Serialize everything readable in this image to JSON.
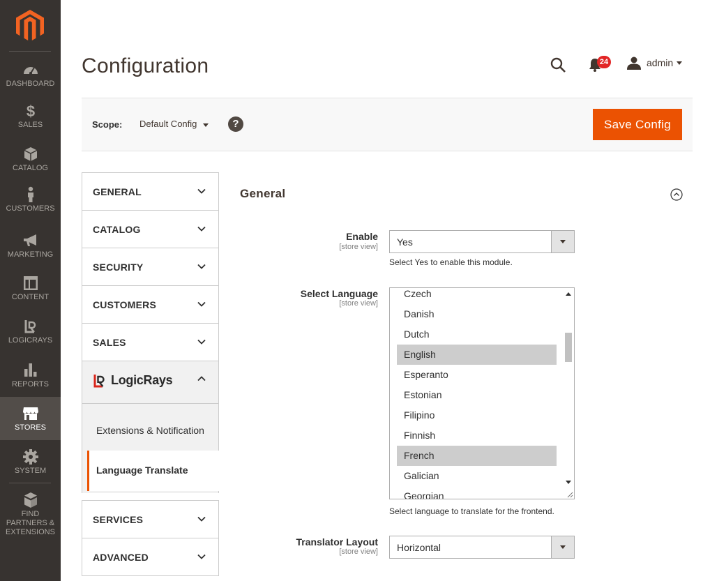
{
  "sidebar": {
    "items": [
      {
        "label": "DASHBOARD",
        "icon": "dashboard-icon"
      },
      {
        "label": "SALES",
        "icon": "dollar-icon"
      },
      {
        "label": "CATALOG",
        "icon": "box-icon"
      },
      {
        "label": "CUSTOMERS",
        "icon": "person-icon"
      },
      {
        "label": "MARKETING",
        "icon": "megaphone-icon"
      },
      {
        "label": "CONTENT",
        "icon": "layout-icon"
      },
      {
        "label": "LOGICRAYS",
        "icon": "logicrays-icon"
      },
      {
        "label": "REPORTS",
        "icon": "bar-chart-icon"
      },
      {
        "label": "STORES",
        "icon": "store-icon",
        "active": true
      },
      {
        "label": "SYSTEM",
        "icon": "gear-icon"
      },
      {
        "label": "FIND PARTNERS & EXTENSIONS",
        "icon": "blocks-icon"
      }
    ]
  },
  "header": {
    "title": "Configuration",
    "notifications_count": "24",
    "user": "admin"
  },
  "scope": {
    "label": "Scope:",
    "value": "Default Config",
    "help": "?",
    "save_label": "Save Config"
  },
  "tabs": {
    "general": "GENERAL",
    "catalog": "CATALOG",
    "security": "SECURITY",
    "customers": "CUSTOMERS",
    "sales": "SALES",
    "logicrays": "LogicRays",
    "sub_extensions": "Extensions & Notification",
    "sub_language": "Language Translate",
    "services": "SERVICES",
    "advanced": "ADVANCED"
  },
  "section": {
    "title": "General",
    "enable": {
      "label": "Enable",
      "scope": "[store view]",
      "value": "Yes",
      "note": "Select Yes to enable this module."
    },
    "language": {
      "label": "Select Language",
      "scope": "[store view]",
      "options": [
        "Czech",
        "Danish",
        "Dutch",
        "English",
        "Esperanto",
        "Estonian",
        "Filipino",
        "Finnish",
        "French",
        "Galician",
        "Georgian"
      ],
      "selected": [
        "English",
        "French"
      ],
      "note": "Select language to translate for the frontend."
    },
    "layout": {
      "label": "Translator Layout",
      "scope": "[store view]",
      "value": "Horizontal"
    }
  },
  "colors": {
    "accent": "#eb5202",
    "sidebar": "#373330",
    "sidebar_active": "#524d49"
  }
}
